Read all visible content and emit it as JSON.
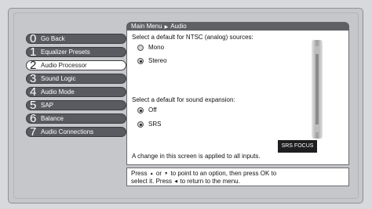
{
  "breadcrumb": {
    "root": "Main Menu",
    "current": "Audio"
  },
  "menu": {
    "items": [
      {
        "num": "0",
        "label": "Go Back",
        "selected": false
      },
      {
        "num": "1",
        "label": "Equalizer Presets",
        "selected": false
      },
      {
        "num": "2",
        "label": "Audio Processor",
        "selected": true
      },
      {
        "num": "3",
        "label": "Sound Logic",
        "selected": false
      },
      {
        "num": "4",
        "label": "Audio Mode",
        "selected": false
      },
      {
        "num": "5",
        "label": "SAP",
        "selected": false
      },
      {
        "num": "6",
        "label": "Balance",
        "selected": false
      },
      {
        "num": "7",
        "label": "Audio Connections",
        "selected": false
      }
    ]
  },
  "content": {
    "ntsc_prompt": "Select a default for NTSC (analog) sources:",
    "ntsc_options": [
      {
        "label": "Mono",
        "checked": false
      },
      {
        "label": "Stereo",
        "checked": true
      }
    ],
    "expansion_prompt": "Select a default for sound expansion:",
    "expansion_options": [
      {
        "label": "Off",
        "checked": true
      },
      {
        "label": "SRS",
        "checked": true
      }
    ],
    "note": "A change in this screen is applied to all inputs.",
    "badge": "SRS FOCUS"
  },
  "help": {
    "line1_a": "Press",
    "line1_b": "or",
    "line1_c": "to point to an option, then press OK to",
    "line2_a": "select it. Press",
    "line2_b": "to return to the menu."
  },
  "colors": {
    "menu_item": "#5a5b60",
    "menu_selected": "#ffffff",
    "breadcrumb": "#5f6064",
    "background": "#c6c7cb"
  }
}
